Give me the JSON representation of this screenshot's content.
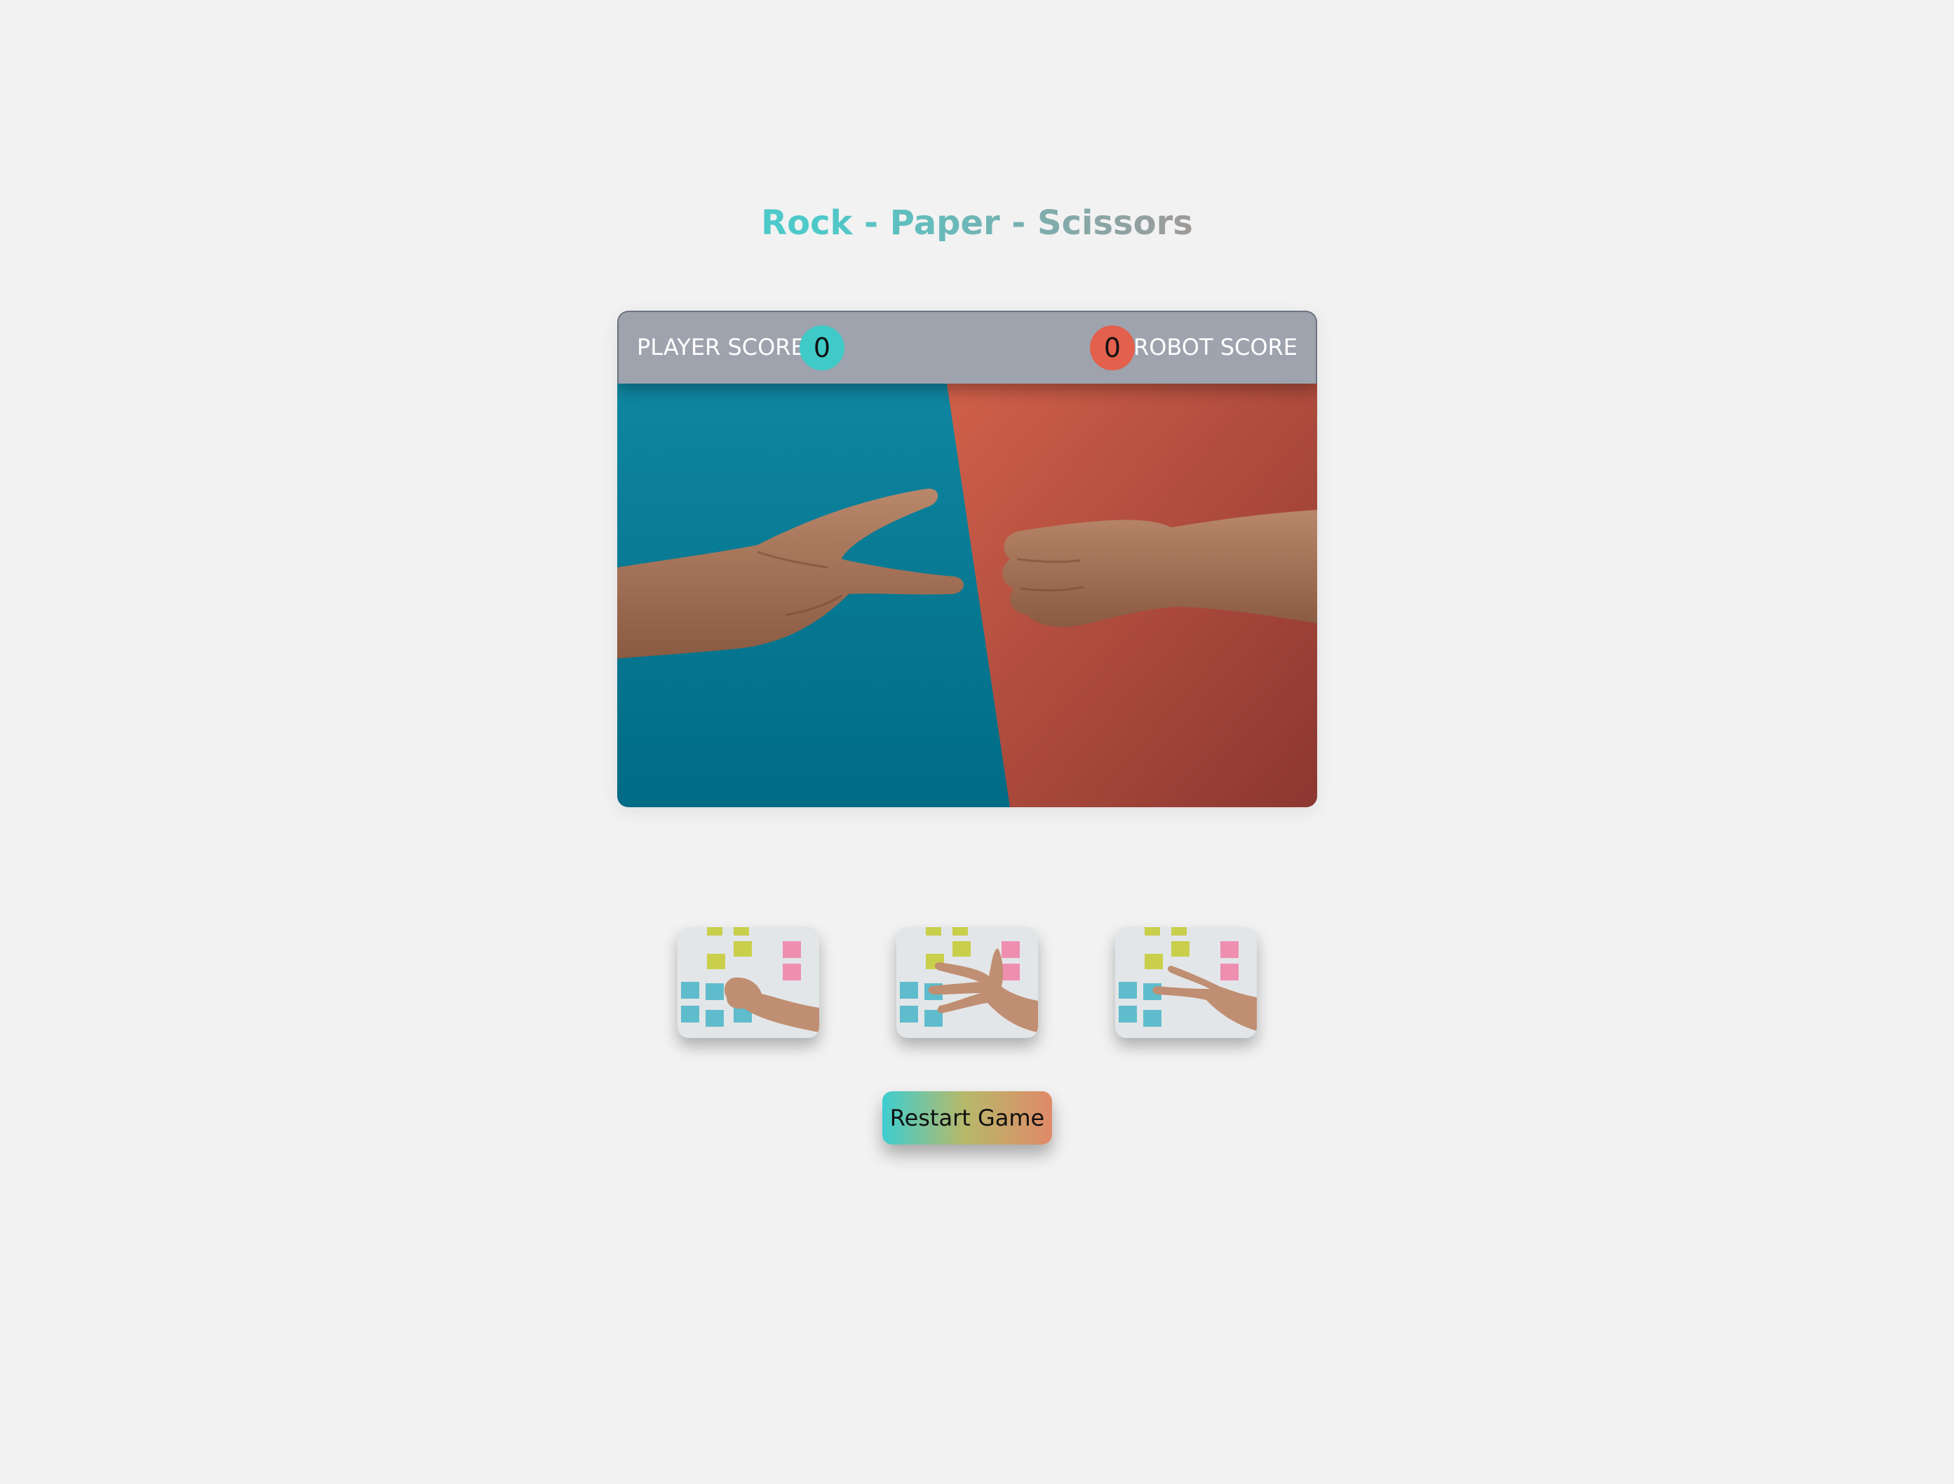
{
  "game": {
    "title": "Rock - Paper - Scissors"
  },
  "scoreboard": {
    "player_label": "PLAYER SCORE",
    "player_score": "0",
    "robot_label": "ROBOT SCORE",
    "robot_score": "0",
    "player_color": "#3fcac8",
    "robot_color": "#e2604c"
  },
  "scene": {
    "description_icons": [
      "scissors-hand-icon",
      "rock-fist-icon"
    ],
    "left_background": "#0a7f98",
    "right_background": "#c75744"
  },
  "choices": [
    {
      "icon": "rock-hand-icon"
    },
    {
      "icon": "paper-hand-icon"
    },
    {
      "icon": "scissors-hand-icon"
    }
  ],
  "controls": {
    "restart_label": "Restart Game"
  }
}
